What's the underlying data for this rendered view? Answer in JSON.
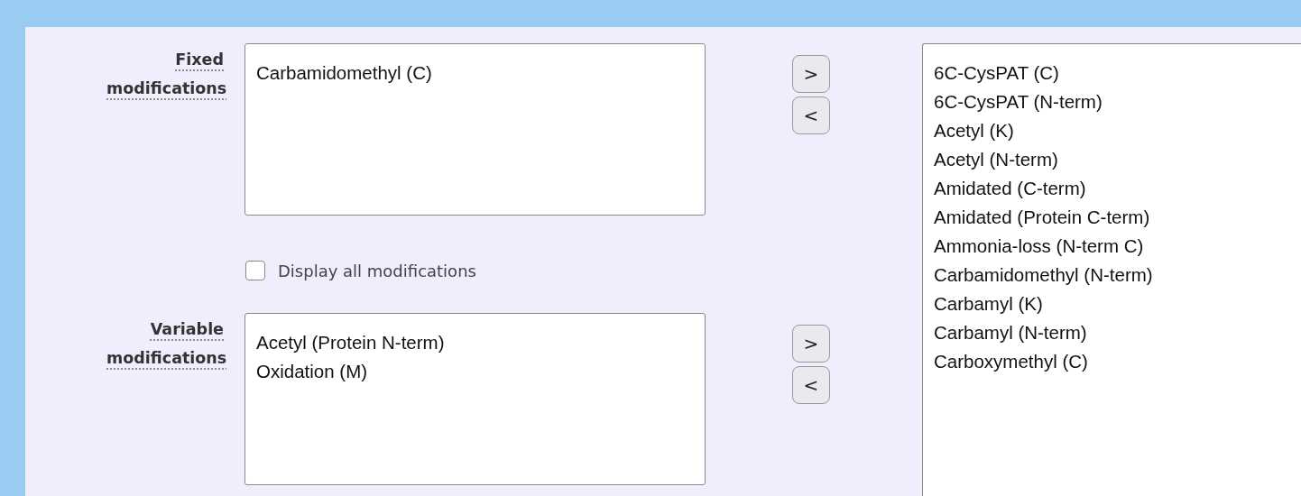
{
  "fixed_modifications": {
    "label": "Fixed modifications",
    "items": [
      {
        "text": "Carbamidomethyl (C)",
        "selected": false
      }
    ],
    "buttons": [
      ">",
      "<"
    ]
  },
  "display_all": {
    "label": "Display all modifications",
    "checked": false
  },
  "variable_modifications": {
    "label": "Variable modifications",
    "items": [
      {
        "text": "Acetyl (Protein N-term)",
        "selected": false
      },
      {
        "text": "Oxidation (M)",
        "selected": false
      }
    ],
    "buttons": [
      ">",
      "<"
    ]
  },
  "available_modifications": {
    "items": [
      {
        "text": "6C-CysPAT (C)",
        "selected": false
      },
      {
        "text": "6C-CysPAT (N-term)",
        "selected": false
      },
      {
        "text": "Acetyl (K)",
        "selected": false
      },
      {
        "text": "Acetyl (N-term)",
        "selected": false
      },
      {
        "text": "Amidated (C-term)",
        "selected": false
      },
      {
        "text": "Amidated (Protein C-term)",
        "selected": false
      },
      {
        "text": "Ammonia-loss (N-term C)",
        "selected": false
      },
      {
        "text": "Carbamidomethyl (N-term)",
        "selected": false
      },
      {
        "text": "Carbamyl (K)",
        "selected": false
      },
      {
        "text": "Carbamyl (N-term)",
        "selected": false
      },
      {
        "text": "Carboxymethyl (C)",
        "selected": false
      }
    ]
  }
}
